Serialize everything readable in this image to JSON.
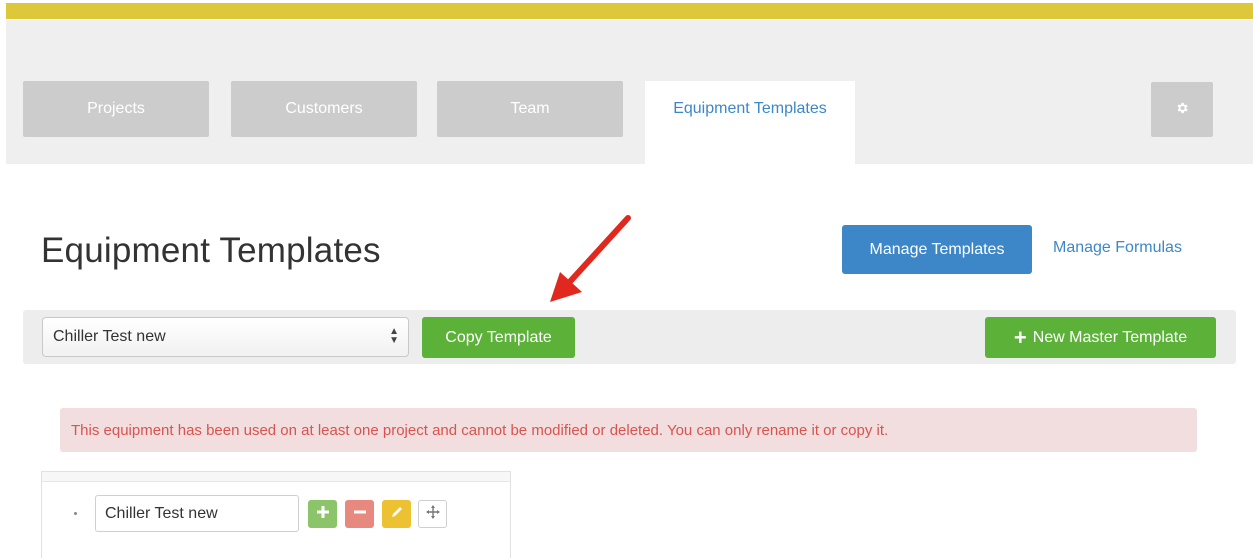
{
  "nav": {
    "tabs": [
      {
        "label": "Projects"
      },
      {
        "label": "Customers"
      },
      {
        "label": "Team"
      },
      {
        "label": "Equipment Templates",
        "active": true
      }
    ],
    "settings_icon": "gear-icon"
  },
  "page": {
    "title": "Equipment Templates",
    "manage_templates_label": "Manage Templates",
    "manage_formulas_label": "Manage Formulas"
  },
  "toolbar": {
    "template_select_value": "Chiller Test new",
    "copy_label": "Copy Template",
    "new_master_label": "New Master Template"
  },
  "alert": {
    "message": "This equipment has been used on at least one project and cannot be modified or deleted. You can only rename it or copy it."
  },
  "tree": {
    "root_node_value": "Chiller Test new",
    "actions": [
      "plus-icon",
      "minus-icon",
      "pencil-icon",
      "move-icon"
    ]
  },
  "colors": {
    "brand_stripe": "#dcc83a",
    "primary": "#3d87c9",
    "success": "#5cb239",
    "danger_bg": "#f2dede",
    "danger_text": "#d9534f",
    "annotation_arrow": "#e0281e"
  }
}
